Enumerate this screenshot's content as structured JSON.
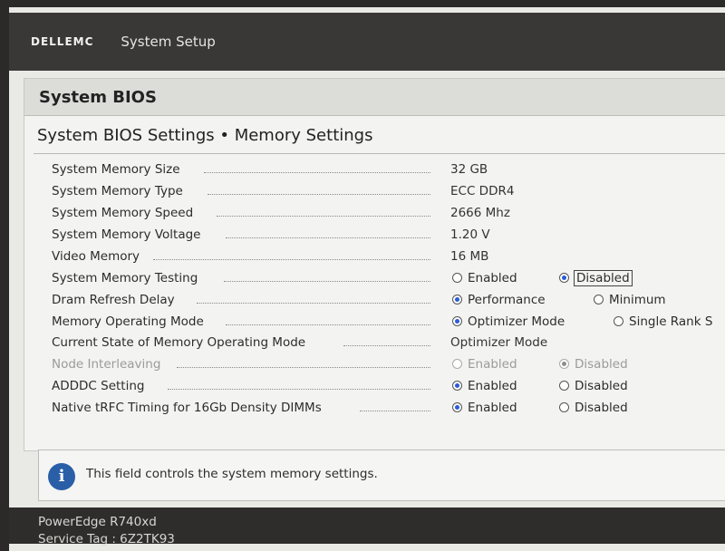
{
  "header": {
    "logo": "DELLEMC",
    "title": "System Setup"
  },
  "page": {
    "title": "System BIOS",
    "section": "System BIOS Settings • Memory Settings"
  },
  "settings": [
    {
      "label": "System Memory Size",
      "value": "32 GB"
    },
    {
      "label": "System Memory Type",
      "value": "ECC DDR4"
    },
    {
      "label": "System Memory Speed",
      "value": "2666 Mhz"
    },
    {
      "label": "System Memory Voltage",
      "value": "1.20 V"
    },
    {
      "label": "Video Memory",
      "value": "16 MB"
    },
    {
      "label": "System Memory Testing",
      "options": [
        "Enabled",
        "Disabled"
      ],
      "selected": "Disabled"
    },
    {
      "label": "Dram Refresh Delay",
      "options": [
        "Performance",
        "Minimum"
      ],
      "selected": "Performance"
    },
    {
      "label": "Memory Operating Mode",
      "options": [
        "Optimizer Mode",
        "Single Rank S"
      ],
      "selected": "Optimizer Mode"
    },
    {
      "label": "Current State of Memory Operating Mode",
      "value": "Optimizer Mode"
    },
    {
      "label": "Node Interleaving",
      "options": [
        "Enabled",
        "Disabled"
      ],
      "selected": "Disabled",
      "disabled": true
    },
    {
      "label": "ADDDC Setting",
      "options": [
        "Enabled",
        "Disabled"
      ],
      "selected": "Enabled"
    },
    {
      "label": "Native tRFC Timing for 16Gb Density DIMMs",
      "options": [
        "Enabled",
        "Disabled"
      ],
      "selected": "Enabled"
    }
  ],
  "help": {
    "text": "This field controls the system memory settings."
  },
  "footer": {
    "model": "PowerEdge R740xd",
    "service_tag": "Service Tag : 6Z2TK93"
  },
  "colors": {
    "accent": "#2a5bd7",
    "info_icon": "#2a5fa8",
    "header_bg": "#3a3836"
  }
}
